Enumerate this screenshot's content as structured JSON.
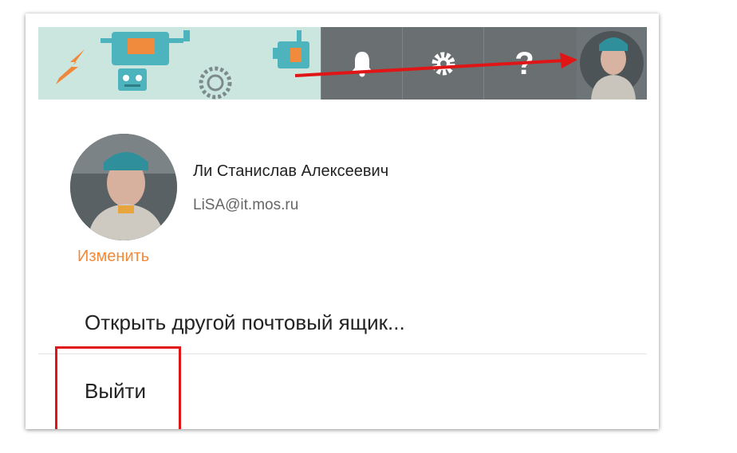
{
  "user": {
    "full_name": "Ли Станислав Алексеевич",
    "email": "LiSA@it.mos.ru",
    "change_photo_label": "Изменить"
  },
  "header": {
    "icons": [
      "lightning-icon",
      "robot-icon",
      "gear-cog-icon",
      "bell-icon",
      "settings-gear-icon",
      "help-icon"
    ],
    "help_symbol": "?"
  },
  "menu": {
    "open_other_mailbox": "Открыть другой почтовый ящик...",
    "logout": "Выйти"
  },
  "colors": {
    "accent": "#f08a3c",
    "annotation_red": "#e01515",
    "header_dark": "#6a6f72",
    "banner_bg": "#cbe6df"
  }
}
